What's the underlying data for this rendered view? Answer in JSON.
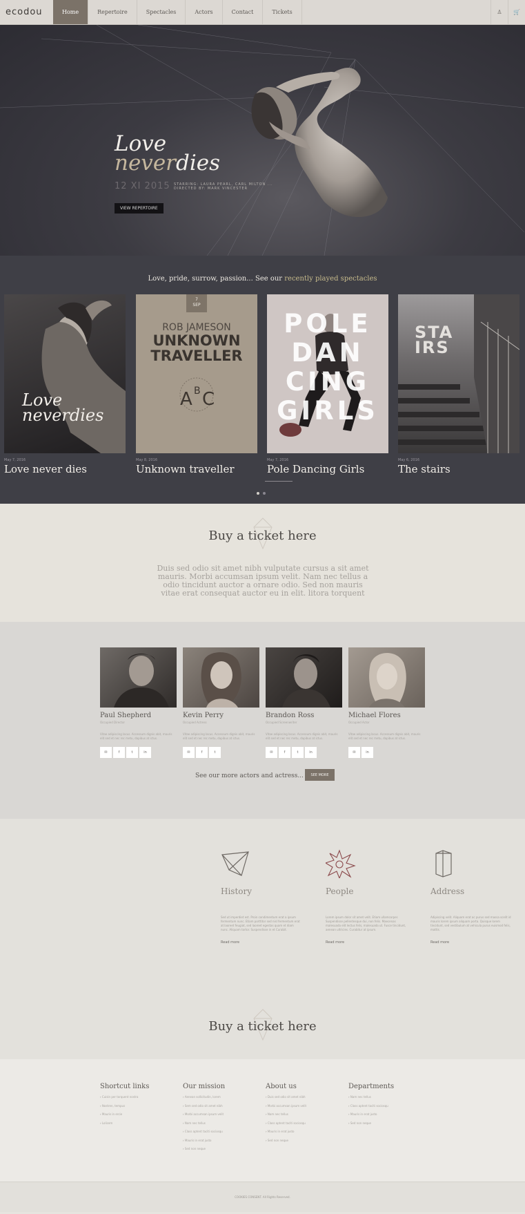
{
  "nav": {
    "logo": "ecodou",
    "items": [
      "Home",
      "Repertoire",
      "Spectacles",
      "Actors",
      "Contact",
      "Tickets"
    ],
    "user_icon": "♙",
    "cart_icon": "🛒"
  },
  "hero": {
    "title_a": "Love",
    "title_b1": "never",
    "title_b2": "dies",
    "date": "12 XI 2015",
    "credit1": "STARRING: LAURA PEARL, CARL MILTON ...",
    "credit2": "DIRECTED BY: MARK VINCESTER",
    "button": "VIEW REPERTOIRE"
  },
  "spectacles": {
    "heading": "Love, pride, surrow, passion... See our ",
    "heading_link": "recently played spectacles",
    "cards": [
      {
        "date": "May 7, 2016",
        "title": "Love never dies",
        "poster_a": "Love",
        "poster_b": "neverdies"
      },
      {
        "date": "May 8, 2016",
        "title": "Unknown traveller",
        "poster_author": "ROB JAMESON",
        "poster_l1": "UNKNOWN",
        "poster_l2": "TRAVELLER",
        "badge_day": "7",
        "badge_month": "SEP"
      },
      {
        "date": "May 7, 2016",
        "title": "Pole Dancing Girls",
        "poster_l1": "POLE",
        "poster_l2": "DAN",
        "poster_l3": "CING",
        "poster_l4": "GIRLS"
      },
      {
        "date": "May 6, 2016",
        "title": "The stairs",
        "poster_l1": "STA",
        "poster_l2": "IRS"
      }
    ]
  },
  "buy": {
    "title": "Buy a ticket here",
    "text": "Duis sed odio sit amet nibh vulputate cursus a sit amet mauris. Morbi accumsan ipsum velit. Nam nec tellus a odio tincidunt auctor a ornare odio. Sed non mauris vitae erat consequat auctor eu in elit. litora torquent"
  },
  "actors": {
    "people": [
      {
        "name": "Paul Shepherd",
        "role": "Occupied Director"
      },
      {
        "name": "Kevin Perry",
        "role": "Occupied Actress"
      },
      {
        "name": "Brandon Ross",
        "role": "Occupied Screenwriter"
      },
      {
        "name": "Michael Flores",
        "role": "Occupied Actor"
      }
    ],
    "bio": "Vitae adipiscing lacus. Accessum dignis abit, mauris elit sed et nec rec metu, dapibus at ictus.",
    "more_text": "See our more actors and actress...",
    "more_button": "SEE MORE"
  },
  "features": [
    {
      "title": "History",
      "text": "Sed ut imperdiet est. Proin condimentum erat a ipsum fermentum nunc. Etiam porttitor sed nisl fermentum erat at laoreet feugiat, sed laoreet egestas quam et diam nunc. Aliquam tortor. Suspendisse in et Curabit.",
      "more": "Read more"
    },
    {
      "title": "People",
      "text": "Lorem ipsum dolor sit amet velit. Etiam ullamcorper. Suspendisse pellentesque dui, non felis. Maecenas malesuada elit lectus felis, malesuada ut. Fusce tincidunt, aenean ultricies. Curabitur at ipsum.",
      "more": "Read more"
    },
    {
      "title": "Address",
      "text": "Adipiscing velit. Aliquam erat ac purus sed massa scelit id mauris lorem ipsum aliquam porta. Quisque lorem tincidunt, sed vestibulum at vehicula purus euismod felis, mattis.",
      "more": "Read more"
    }
  ],
  "buy2": {
    "title": "Buy a ticket here"
  },
  "footer": {
    "columns": [
      {
        "title": "Shortcut links",
        "items": [
          "Cuisin per torquent nostra",
          "Nostren, tempus",
          "Mauris in ercie",
          "Lolicem"
        ]
      },
      {
        "title": "Our mission",
        "items": [
          "Aenean sollicitudin, lorem",
          "Sem sed odio sit amet nibh",
          "Morbi accumsan ipsum velit",
          "Nam nec tellus",
          "Class aptent taciti sociosqu",
          "Mauris in erat justo",
          "Sed non neque"
        ]
      },
      {
        "title": "About us",
        "items": [
          "Duis sed odio sit amet nibh",
          "Morbi accumsan ipsum velit",
          "Nam nec tellus",
          "Class aptent taciti sociosqu",
          "Mauris in erat justo",
          "Sed non neque"
        ]
      },
      {
        "title": "Departments",
        "items": [
          "Nam nec tellus",
          "Class aptent taciti sociosqu",
          "Mauris in erat justo",
          "Sed non neque"
        ]
      }
    ],
    "copyright": "COOKIES CONSENT. All Rights Reserved."
  },
  "colors": {
    "accent": "#7b7268",
    "link": "#c7bb8c",
    "dark": "#3f3f46"
  }
}
